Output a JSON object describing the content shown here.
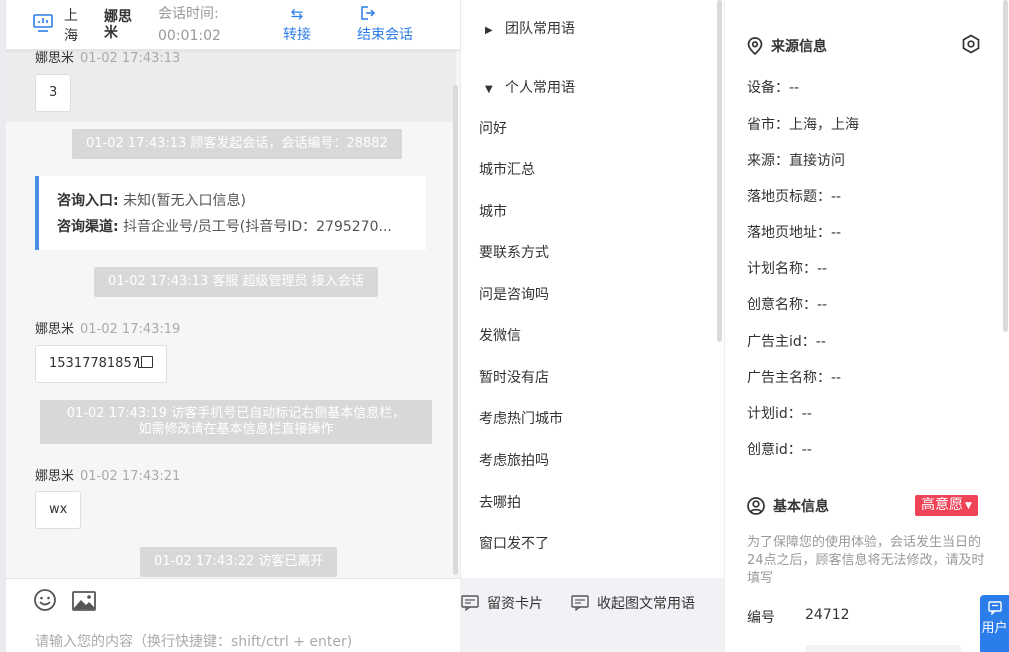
{
  "header": {
    "city": "上海",
    "visitor_name": "娜思米",
    "time_label": "会话时间:",
    "time_value": "00:01:02",
    "transfer_label": "转接",
    "end_label": "结束会话"
  },
  "messages": {
    "m1_name": "娜思米",
    "m1_time": "01-02 17:43:13",
    "m1_text": "3",
    "sys1": "01-02 17:43:13 顾客发起会话，会话编号：28882",
    "entry_label": "咨询入口:",
    "entry_value": "未知(暂无入口信息)",
    "channel_label": "咨询渠道:",
    "channel_value": "抖音企业号/员工号(抖音号ID：2795270...",
    "sys2": "01-02 17:43:13 客服 超级管理员 接入会话",
    "m2_name": "娜思米",
    "m2_time": "01-02 17:43:19",
    "m2_text": "15317781857",
    "sys3_line1": "01-02 17:43:19 访客手机号已自动标记右侧基本信息栏，",
    "sys3_line2": "如需修改请在基本信息栏直接操作",
    "m3_name": "娜思米",
    "m3_time": "01-02 17:43:21",
    "m3_text": "wx",
    "sys4": "01-02 17:43:22 访客已离开"
  },
  "input": {
    "card_label": "留资卡片",
    "collapse_label": "收起图文常用语",
    "placeholder": "请输入您的内容（换行快捷键：shift/ctrl + enter)"
  },
  "phrases": {
    "team_group": "团队常用语",
    "personal_group": "个人常用语",
    "items": [
      "问好",
      "城市汇总",
      "城市",
      "要联系方式",
      "问是咨询吗",
      "发微信",
      "暂时没有店",
      "考虑热门城市",
      "考虑旅拍吗",
      "去哪拍",
      "窗口发不了"
    ]
  },
  "source_info": {
    "title": "来源信息",
    "rows": [
      "设备：--",
      "省市：上海，上海",
      "来源：直接访问",
      "落地页标题：--",
      "落地页地址：--",
      "计划名称：--",
      "创意名称：--",
      "广告主id：--",
      "广告主名称：--",
      "计划id：--",
      "创意id：--"
    ]
  },
  "basic_info": {
    "title": "基本信息",
    "intent_badge": "高意愿",
    "notice": "为了保障您的使用体验，会话发生当日的24点之后，顾客信息将无法修改，请及时填写",
    "id_label": "编号",
    "id_value": "24712"
  },
  "help_tab": {
    "label": "用户"
  },
  "colors": {
    "accent_blue": "#2b7de9",
    "badge_red": "#ef4358",
    "system_msg_bg": "#d8d8d8"
  }
}
